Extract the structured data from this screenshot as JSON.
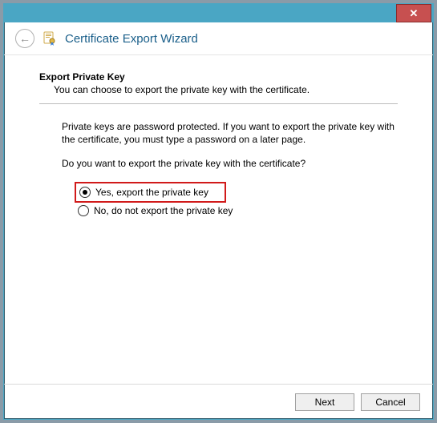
{
  "window": {
    "close_label": "✕"
  },
  "header": {
    "title": "Certificate Export Wizard"
  },
  "content": {
    "heading": "Export Private Key",
    "sub": "You can choose to export the private key with the certificate.",
    "explain": "Private keys are password protected. If you want to export the private key with the certificate, you must type a password on a later page.",
    "question": "Do you want to export the private key with the certificate?",
    "option_yes": "Yes, export the private key",
    "option_no": "No, do not export the private key",
    "selected": "yes"
  },
  "footer": {
    "next": "Next",
    "cancel": "Cancel"
  }
}
